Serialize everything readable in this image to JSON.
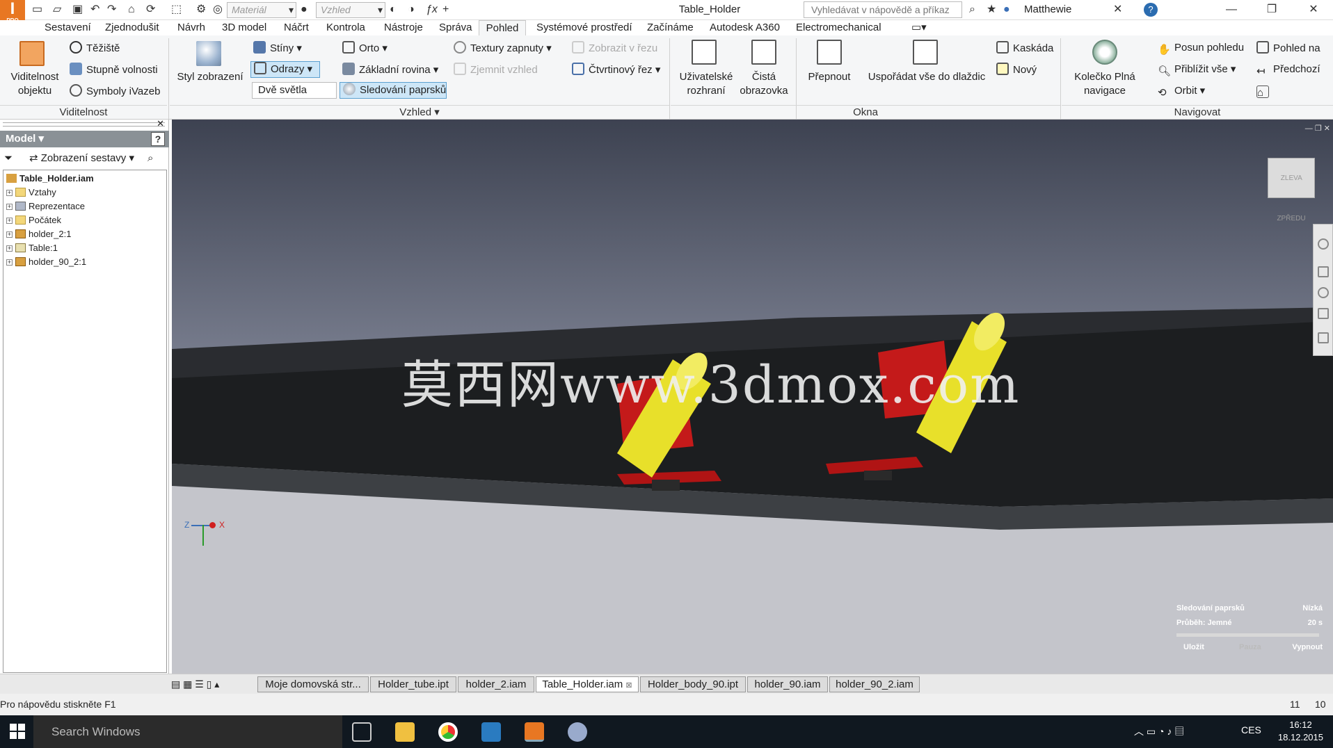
{
  "titlebar": {
    "logo": "I",
    "logo_sub": "PRO",
    "material_placeholder": "Materiál",
    "appearance_placeholder": "Vzhled",
    "doc_title": "Table_Holder",
    "help_search": "Vyhledávat v nápovědě a příkaz",
    "user": "Matthewie",
    "help_icon": "?"
  },
  "menu": {
    "tabs": [
      "Sestavení",
      "Zjednodušit",
      "Návrh",
      "3D model",
      "Náčrt",
      "Kontrola",
      "Nástroje",
      "Správa",
      "Pohled",
      "Systémové prostředí",
      "Začínáme",
      "Autodesk A360",
      "Electromechanical"
    ],
    "active": "Pohled"
  },
  "ribbon": {
    "visibility": {
      "object_visibility": "Viditelnost objektu",
      "center_of_gravity": "Těžiště",
      "dof": "Stupně volnosti",
      "symbols": "Symboly iVazeb",
      "group": "Viditelnost"
    },
    "appearance": {
      "visual_style": "Styl zobrazení",
      "shadows": "Stíny",
      "reflections": "Odrazy",
      "lighting": "Dvě světla",
      "ortho": "Orto",
      "ground_plane": "Základní rovina",
      "ray_tracing": "Sledování paprsků",
      "textures_on": "Textury zapnuty",
      "refine_appearance": "Zjemnit vzhled",
      "section_view": "Zobrazit v řezu",
      "quarter_section": "Čtvrtinový řez",
      "group": "Vzhled"
    },
    "windows": {
      "user_interface": "Uživatelské rozhraní",
      "clean_screen": "Čistá obrazovka",
      "switch": "Přepnout",
      "arrange_all": "Uspořádat vše do dlaždic",
      "cascade": "Kaskáda",
      "new": "Nový",
      "group": "Okna"
    },
    "navigate": {
      "wheel": "Kolečko Plná navigace",
      "pan": "Posun pohledu",
      "zoom_all": "Přiblížit vše",
      "orbit": "Orbit",
      "look_at": "Pohled na",
      "previous": "Předchozí",
      "group": "Navigovat"
    }
  },
  "browser": {
    "header": "Model",
    "view_mode": "Zobrazení sestavy",
    "help": "?",
    "tree": [
      {
        "label": "Table_Holder.iam",
        "bold": true
      },
      {
        "label": "Vztahy"
      },
      {
        "label": "Reprezentace"
      },
      {
        "label": "Počátek"
      },
      {
        "label": "holder_2:1"
      },
      {
        "label": "Table:1"
      },
      {
        "label": "holder_90_2:1"
      }
    ]
  },
  "viewport": {
    "watermark": "莫西网www.3dmox.com",
    "viewcube_left": "ZLEVA",
    "viewcube_front": "ZPŘEDU",
    "triad_z": "Z",
    "triad_x": "X",
    "raytrace_panel": {
      "label": "Sledování paprsků",
      "quality": "Nízká",
      "progress_label": "Průběh: Jemné",
      "time": "20 s",
      "save": "Uložit",
      "pause": "Pauza",
      "off": "Vypnout"
    }
  },
  "doc_tabs": [
    "Moje domovská str...",
    "Holder_tube.ipt",
    "holder_2.iam",
    "Table_Holder.iam",
    "Holder_body_90.ipt",
    "holder_90.iam",
    "holder_90_2.iam"
  ],
  "active_doc": "Table_Holder.iam",
  "status": {
    "hint": "Pro nápovědu stiskněte F1",
    "n1": "11",
    "n2": "10"
  },
  "taskbar": {
    "search": "Search Windows",
    "lang": "CES",
    "time": "16:12",
    "date": "18.12.2015"
  },
  "colors": {
    "accent": "#e87722",
    "holder_red": "#c41a1a",
    "tube_yellow": "#e8e02a",
    "table_dark": "#202224"
  }
}
